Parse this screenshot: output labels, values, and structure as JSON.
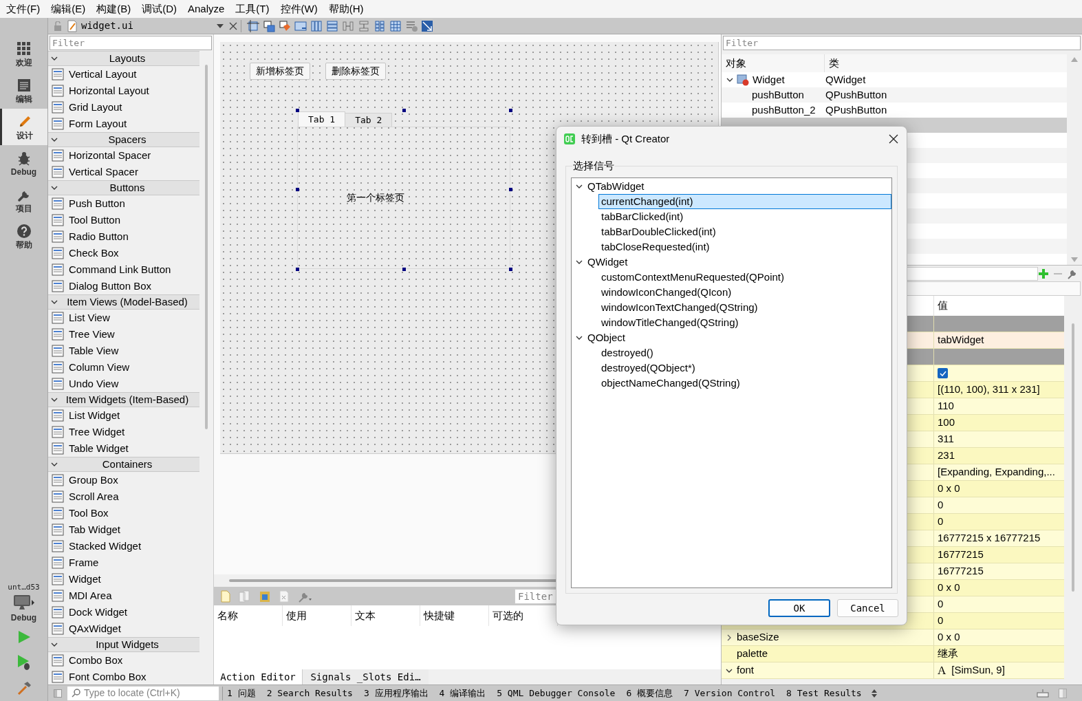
{
  "menu": [
    "文件(F)",
    "编辑(E)",
    "构建(B)",
    "调试(D)",
    "Analyze",
    "工具(T)",
    "控件(W)",
    "帮助(H)"
  ],
  "mode_bar": {
    "items": [
      {
        "label": "欢迎",
        "selected": false
      },
      {
        "label": "编辑",
        "selected": false
      },
      {
        "label": "设计",
        "selected": true
      },
      {
        "label": "Debug",
        "selected": false
      },
      {
        "label": "项目",
        "selected": false
      },
      {
        "label": "帮助",
        "selected": false
      }
    ],
    "kit": {
      "project": "unt…d53",
      "build": "Debug"
    }
  },
  "editor_toolbar": {
    "file": "widget.ui"
  },
  "widget_box": {
    "filter_placeholder": "Filter",
    "categories": [
      {
        "label": "Layouts",
        "expanded": true,
        "items": [
          "Vertical Layout",
          "Horizontal Layout",
          "Grid Layout",
          "Form Layout"
        ]
      },
      {
        "label": "Spacers",
        "expanded": true,
        "items": [
          "Horizontal Spacer",
          "Vertical Spacer"
        ]
      },
      {
        "label": "Buttons",
        "expanded": true,
        "items": [
          "Push Button",
          "Tool Button",
          "Radio Button",
          "Check Box",
          "Command Link Button",
          "Dialog Button Box"
        ]
      },
      {
        "label": "Item Views (Model-Based)",
        "expanded": true,
        "items": [
          "List View",
          "Tree View",
          "Table View",
          "Column View",
          "Undo View"
        ]
      },
      {
        "label": "Item Widgets (Item-Based)",
        "expanded": true,
        "items": [
          "List Widget",
          "Tree Widget",
          "Table Widget"
        ]
      },
      {
        "label": "Containers",
        "expanded": true,
        "items": [
          "Group Box",
          "Scroll Area",
          "Tool Box",
          "Tab Widget",
          "Stacked Widget",
          "Frame",
          "Widget",
          "MDI Area",
          "Dock Widget",
          "QAxWidget"
        ]
      },
      {
        "label": "Input Widgets",
        "expanded": true,
        "items": [
          "Combo Box",
          "Font Combo Box"
        ]
      }
    ]
  },
  "form": {
    "buttons": [
      "新增标签页",
      "删除标签页"
    ],
    "tab_widget": {
      "tabs": [
        {
          "label": "Tab 1",
          "selected": true
        },
        {
          "label": "Tab 2",
          "selected": false
        }
      ],
      "page_text": "第一个标签页"
    }
  },
  "action_editor": {
    "filter_placeholder": "Filter",
    "columns": [
      "名称",
      "使用",
      "文本",
      "快捷键",
      "可选的"
    ],
    "tabs": [
      {
        "label": "Action Editor",
        "selected": true
      },
      {
        "label": "Signals _Slots Edi…",
        "selected": false
      }
    ]
  },
  "object_inspector": {
    "filter_placeholder": "Filter",
    "columns": [
      "对象",
      "类"
    ],
    "rows": [
      {
        "name": "Widget",
        "class": "QWidget",
        "expanded": true,
        "selected": false,
        "children": [
          {
            "name": "pushButton",
            "class": "QPushButton",
            "selected": false
          },
          {
            "name": "pushButton_2",
            "class": "QPushButton",
            "selected": false
          },
          {
            "selected": true
          }
        ]
      }
    ]
  },
  "property_editor": {
    "value_column": "值",
    "rows": [
      {
        "kind": "group"
      },
      {
        "kind": "object_name",
        "value": "tabWidget"
      },
      {
        "kind": "group"
      },
      {
        "kind": "check",
        "checked": true
      },
      {
        "kind": "value",
        "value": "[(110, 100), 311 x 231]"
      },
      {
        "kind": "value",
        "value": "110"
      },
      {
        "kind": "value",
        "value": "100"
      },
      {
        "kind": "value",
        "value": "311"
      },
      {
        "kind": "value",
        "value": "231"
      },
      {
        "kind": "value",
        "value": "[Expanding, Expanding,..."
      },
      {
        "kind": "value",
        "value": "0 x 0"
      },
      {
        "kind": "value",
        "value": "0"
      },
      {
        "kind": "value",
        "value": "0"
      },
      {
        "kind": "value",
        "value": "16777215 x 16777215"
      },
      {
        "kind": "value",
        "value": "16777215"
      },
      {
        "kind": "value",
        "value": "16777215"
      },
      {
        "kind": "value",
        "value": "0 x 0"
      },
      {
        "kind": "value",
        "value": "0"
      },
      {
        "kind": "value",
        "value": "0"
      },
      {
        "kind": "value",
        "name": "baseSize",
        "expanded": false,
        "value": "0 x 0"
      },
      {
        "kind": "value",
        "name": "palette",
        "value": "继承"
      },
      {
        "kind": "font",
        "name": "font",
        "expanded": true,
        "preview": "A",
        "value": "[SimSun, 9]"
      }
    ]
  },
  "status_bar": {
    "locate_placeholder": "Type to locate (Ctrl+K)",
    "panes": [
      "1 问题",
      "2 Search Results",
      "3 应用程序输出",
      "4 编译输出",
      "5 QML Debugger Console",
      "6 概要信息",
      "7 Version Control",
      "8 Test Results"
    ]
  },
  "dialog": {
    "title": "转到槽 - Qt Creator",
    "group": "选择信号",
    "tree": [
      {
        "label": "QTabWidget",
        "expanded": true,
        "selected": false,
        "children": [
          {
            "label": "currentChanged(int)",
            "selected": true
          },
          {
            "label": "tabBarClicked(int)",
            "selected": false
          },
          {
            "label": "tabBarDoubleClicked(int)",
            "selected": false
          },
          {
            "label": "tabCloseRequested(int)",
            "selected": false
          }
        ]
      },
      {
        "label": "QWidget",
        "expanded": true,
        "selected": false,
        "children": [
          {
            "label": "customContextMenuRequested(QPoint)",
            "selected": false
          },
          {
            "label": "windowIconChanged(QIcon)",
            "selected": false
          },
          {
            "label": "windowIconTextChanged(QString)",
            "selected": false
          },
          {
            "label": "windowTitleChanged(QString)",
            "selected": false
          }
        ]
      },
      {
        "label": "QObject",
        "expanded": true,
        "selected": false,
        "children": [
          {
            "label": "destroyed()",
            "selected": false
          },
          {
            "label": "destroyed(QObject*)",
            "selected": false
          },
          {
            "label": "objectNameChanged(QString)",
            "selected": false
          }
        ]
      }
    ],
    "buttons": [
      "OK",
      "Cancel"
    ]
  }
}
